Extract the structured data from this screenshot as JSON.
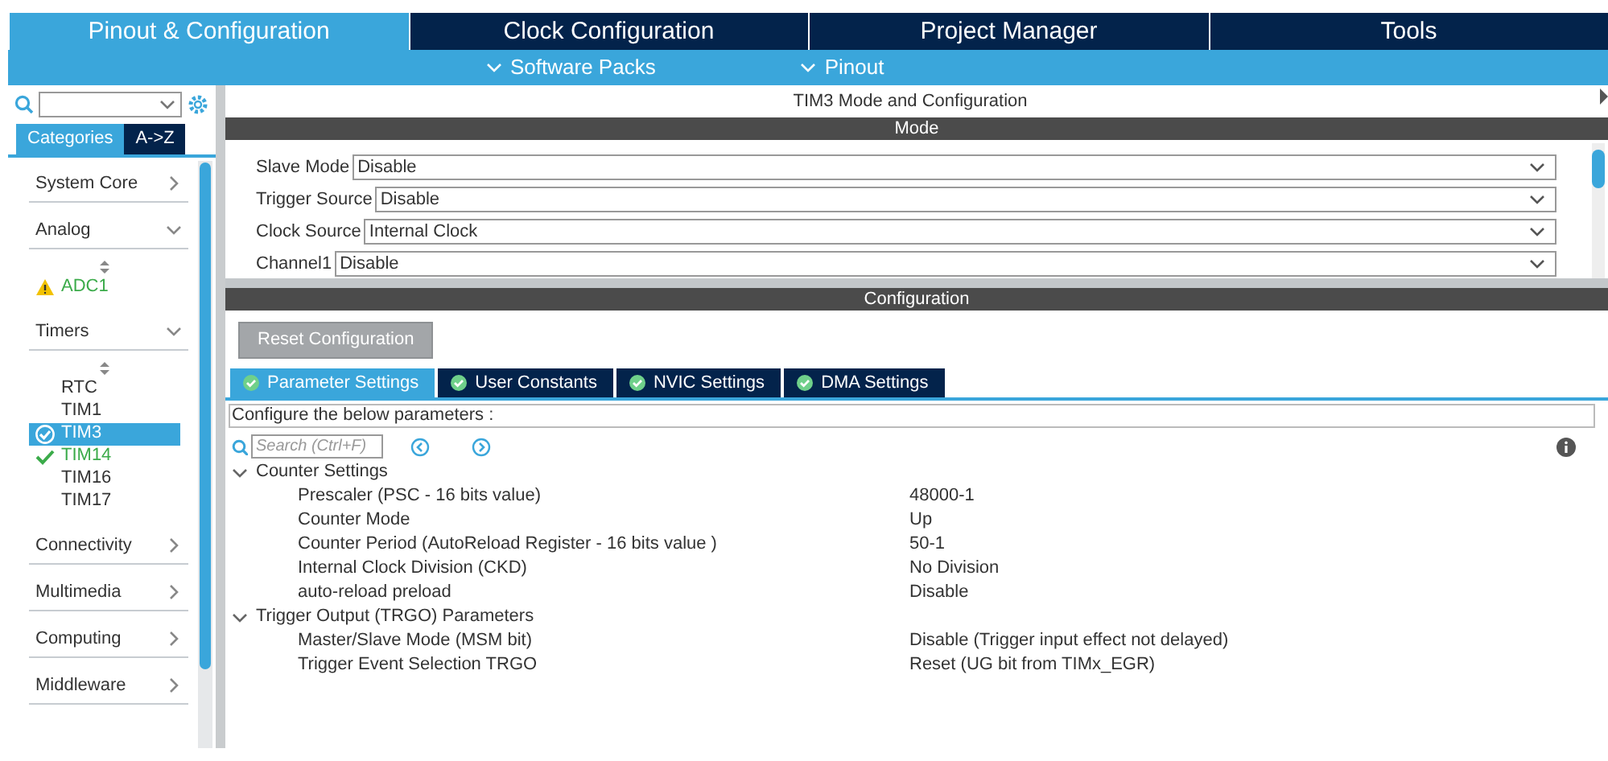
{
  "main_tabs": [
    {
      "label": "Pinout & Configuration",
      "selected": true
    },
    {
      "label": "Clock Configuration",
      "selected": false
    },
    {
      "label": "Project Manager",
      "selected": false
    },
    {
      "label": "Tools",
      "selected": false
    }
  ],
  "submenus": [
    {
      "label": "Software Packs"
    },
    {
      "label": "Pinout"
    }
  ],
  "sidebar": {
    "view_tabs": [
      {
        "label": "Categories",
        "selected": true
      },
      {
        "label": "A->Z",
        "selected": false
      }
    ],
    "categories": [
      {
        "label": "System Core",
        "expanded": false
      },
      {
        "label": "Analog",
        "expanded": true,
        "items": [
          {
            "label": "ADC1",
            "warning": true,
            "configured": false,
            "selected": false
          }
        ]
      },
      {
        "label": "Timers",
        "expanded": true,
        "items": [
          {
            "label": "RTC",
            "warning": false,
            "configured": false,
            "selected": false
          },
          {
            "label": "TIM1",
            "warning": false,
            "configured": false,
            "selected": false
          },
          {
            "label": "TIM3",
            "warning": false,
            "configured": true,
            "selected": true
          },
          {
            "label": "TIM14",
            "warning": false,
            "configured": true,
            "selected": false
          },
          {
            "label": "TIM16",
            "warning": false,
            "configured": false,
            "selected": false
          },
          {
            "label": "TIM17",
            "warning": false,
            "configured": false,
            "selected": false
          }
        ]
      },
      {
        "label": "Connectivity",
        "expanded": false
      },
      {
        "label": "Multimedia",
        "expanded": false
      },
      {
        "label": "Computing",
        "expanded": false
      },
      {
        "label": "Middleware",
        "expanded": false
      }
    ]
  },
  "panel": {
    "title": "TIM3 Mode and Configuration",
    "mode": {
      "header": "Mode",
      "fields": [
        {
          "label": "Slave Mode",
          "value": "Disable"
        },
        {
          "label": "Trigger Source",
          "value": "Disable"
        },
        {
          "label": "Clock Source",
          "value": "Internal Clock"
        },
        {
          "label": "Channel1",
          "value": "Disable"
        }
      ]
    },
    "configuration": {
      "header": "Configuration",
      "reset_button": "Reset Configuration",
      "tabs": [
        {
          "label": "Parameter Settings",
          "selected": true
        },
        {
          "label": "User Constants",
          "selected": false
        },
        {
          "label": "NVIC Settings",
          "selected": false
        },
        {
          "label": "DMA Settings",
          "selected": false
        }
      ],
      "hint": "Configure the below parameters :",
      "search": {
        "placeholder": "Search (Ctrl+F)"
      },
      "groups": [
        {
          "label": "Counter Settings",
          "expanded": true,
          "params": [
            {
              "name": "Prescaler (PSC - 16 bits value)",
              "value": "48000-1"
            },
            {
              "name": "Counter Mode",
              "value": "Up"
            },
            {
              "name": "Counter Period (AutoReload Register - 16 bits value )",
              "value": "50-1"
            },
            {
              "name": "Internal Clock Division (CKD)",
              "value": "No Division"
            },
            {
              "name": "auto-reload preload",
              "value": "Disable"
            }
          ]
        },
        {
          "label": "Trigger Output (TRGO) Parameters",
          "expanded": true,
          "params": [
            {
              "name": "Master/Slave Mode (MSM bit)",
              "value": "Disable (Trigger input effect not delayed)"
            },
            {
              "name": "Trigger Event Selection TRGO",
              "value": "Reset (UG bit from TIMx_EGR)"
            }
          ]
        }
      ]
    }
  }
}
